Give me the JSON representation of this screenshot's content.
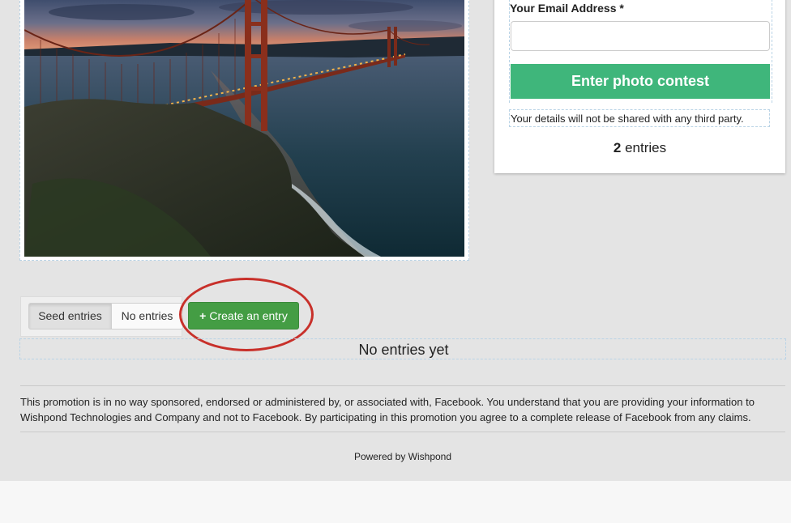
{
  "form": {
    "email_label": "Your Email Address *",
    "email_placeholder": "",
    "submit_label": "Enter photo contest",
    "privacy_note": "Your details will not be shared with any third party.",
    "entries_count": "2",
    "entries_suffix": " entries"
  },
  "entries": {
    "tabs": [
      {
        "label": "Seed entries",
        "selected": true
      },
      {
        "label": "No entries",
        "selected": false
      }
    ],
    "create_label": "Create an entry",
    "create_icon": "plus-icon",
    "empty_message": "No entries yet"
  },
  "footer": {
    "disclaimer": "This promotion is in no way sponsored, endorsed or administered by, or associated with, Facebook. You understand that you are providing your information to Wishpond Technologies and Company and not to Facebook. By participating in this promotion you agree to a complete release of Facebook from any claims.",
    "powered_by": "Powered by Wishpond"
  },
  "colors": {
    "submit_green": "#3fb67b",
    "create_green": "#449d44",
    "highlight_red": "#c8302a",
    "page_bg": "#e4e4e4"
  }
}
